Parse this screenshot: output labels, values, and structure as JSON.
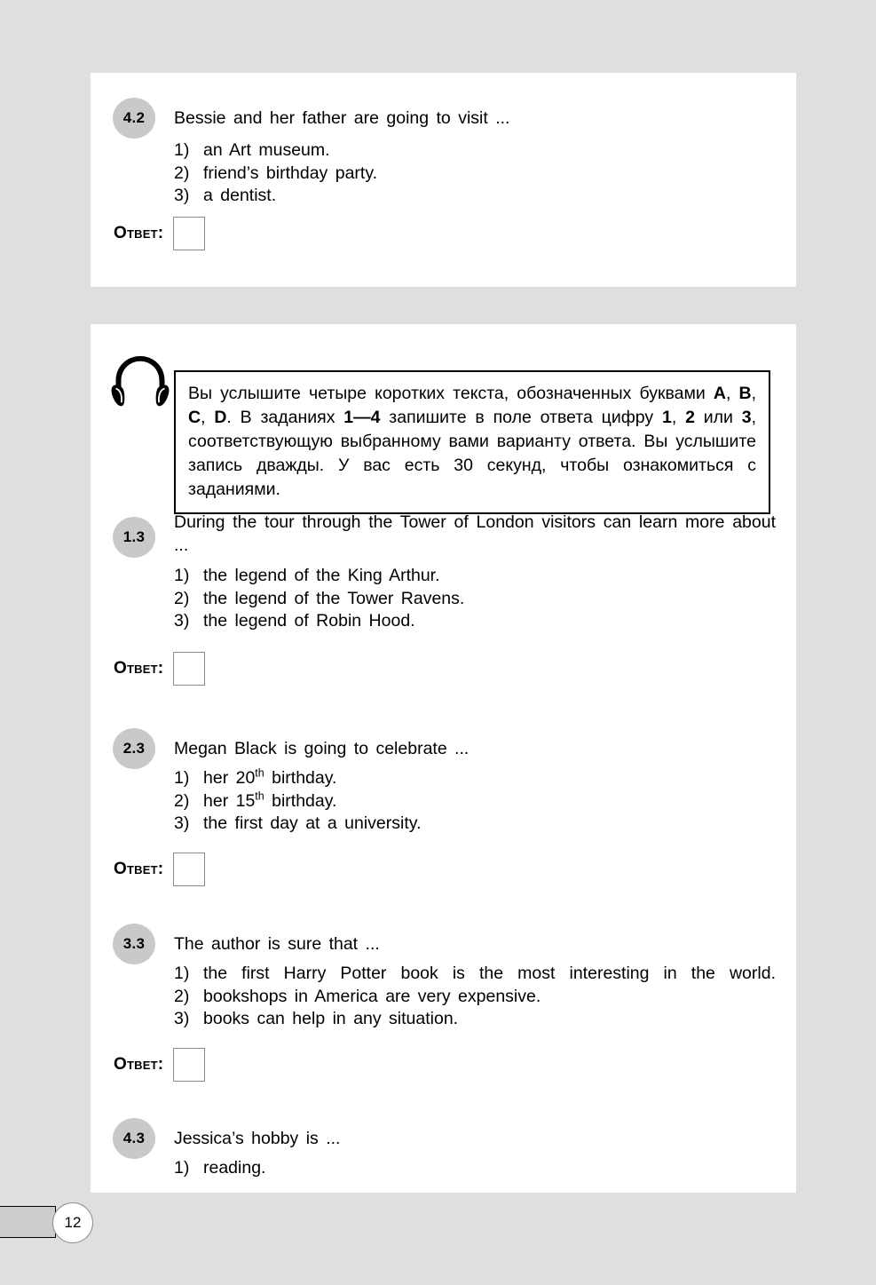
{
  "page": {
    "number": "12",
    "answer_label": "Ответ:"
  },
  "top_panel": {
    "question": {
      "number": "4.2",
      "stem": "Bessie  and  her  father  are  going  to  visit  ...",
      "options": [
        {
          "num": "1)",
          "text": "an  Art  museum."
        },
        {
          "num": "2)",
          "text": "friend’s  birthday  party."
        },
        {
          "num": "3)",
          "text": "a  dentist."
        }
      ]
    }
  },
  "instruction": {
    "icon": "headphones-icon",
    "text_parts": [
      {
        "t": "Вы услышите четыре коротких текста, обозначенных буква­ми ",
        "b": false
      },
      {
        "t": "A",
        "b": true
      },
      {
        "t": ", ",
        "b": false
      },
      {
        "t": "B",
        "b": true
      },
      {
        "t": ", ",
        "b": false
      },
      {
        "t": "C",
        "b": true
      },
      {
        "t": ", ",
        "b": false
      },
      {
        "t": "D",
        "b": true
      },
      {
        "t": ". В заданиях ",
        "b": false
      },
      {
        "t": "1—4",
        "b": true
      },
      {
        "t": " запишите в поле ответа цифру ",
        "b": false
      },
      {
        "t": "1",
        "b": true
      },
      {
        "t": ", ",
        "b": false
      },
      {
        "t": "2",
        "b": true
      },
      {
        "t": " или ",
        "b": false
      },
      {
        "t": "3",
        "b": true
      },
      {
        "t": ", соответствующую выбранному вами вари­анту ответа. Вы услышите запись дважды. У вас есть 30 се­кунд, чтобы ознакомиться с заданиями.",
        "b": false
      }
    ]
  },
  "questions": [
    {
      "number": "1.3",
      "stem": "During  the  tour  through  the  Tower  of  London  visitors  can  learn more  about  ...",
      "stem_justify_all": false,
      "options": [
        {
          "num": "1)",
          "text": "the  legend  of  the  King  Arthur.",
          "justify_all": false
        },
        {
          "num": "2)",
          "text": "the  legend  of  the  Tower  Ravens.",
          "justify_all": false
        },
        {
          "num": "3)",
          "text": "the  legend  of  Robin  Hood.",
          "justify_all": false
        }
      ],
      "has_answer_box": true
    },
    {
      "number": "2.3",
      "stem": "Megan  Black  is  going  to  celebrate  ...",
      "stem_justify_all": false,
      "options": [
        {
          "num": "1)",
          "text": "her  20",
          "sup": "th",
          "text_after": "  birthday.",
          "justify_all": false
        },
        {
          "num": "2)",
          "text": "her  15",
          "sup": "th",
          "text_after": "  birthday.",
          "justify_all": false
        },
        {
          "num": "3)",
          "text": "the  first  day  at  a  university.",
          "justify_all": false
        }
      ],
      "has_answer_box": true
    },
    {
      "number": "3.3",
      "stem": "The  author  is  sure  that  ...",
      "stem_justify_all": false,
      "options": [
        {
          "num": "1)",
          "text": "the first Harry Potter book is the most interesting in the world.",
          "justify_all": true
        },
        {
          "num": "2)",
          "text": "bookshops  in  America  are  very  expensive.",
          "justify_all": false
        },
        {
          "num": "3)",
          "text": "books  can  help  in  any  situation.",
          "justify_all": false
        }
      ],
      "has_answer_box": true
    },
    {
      "number": "4.3",
      "stem": "Jessica’s  hobby  is  ...",
      "stem_justify_all": false,
      "options": [
        {
          "num": "1)",
          "text": "reading.",
          "justify_all": false
        }
      ],
      "has_answer_box": false
    }
  ]
}
